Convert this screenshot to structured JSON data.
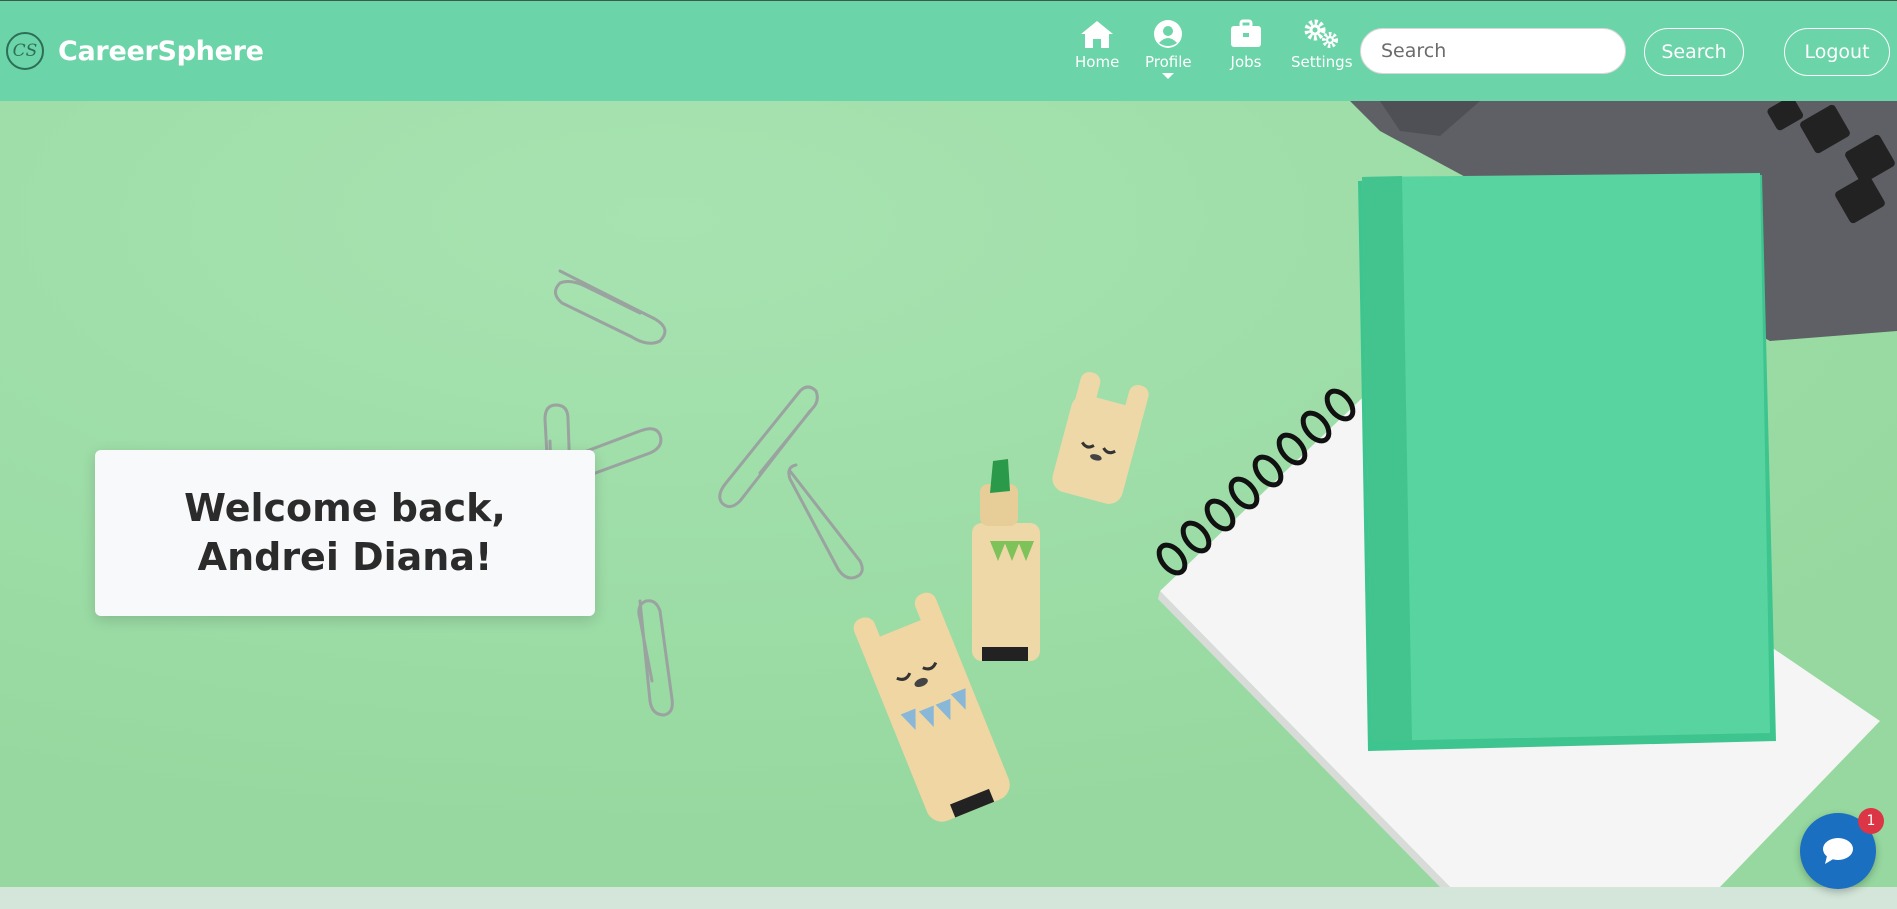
{
  "brand": {
    "logo_text": "CS",
    "name": "CareerSphere"
  },
  "nav": {
    "items": [
      {
        "label": "Home",
        "icon": "home-icon"
      },
      {
        "label": "Profile",
        "icon": "user-circle-icon",
        "has_dropdown": true
      },
      {
        "label": "Jobs",
        "icon": "briefcase-icon"
      },
      {
        "label": "Settings",
        "icon": "cogs-icon"
      }
    ],
    "search_placeholder": "Search",
    "search_button": "Search",
    "logout_button": "Logout"
  },
  "hero": {
    "welcome_message": "Welcome back, Andrei Diana!"
  },
  "chat": {
    "icon": "chat-bubble-icon",
    "badge_count": "1"
  },
  "colors": {
    "navbar": "#6bd4a8",
    "hero_background": "#9fdba7",
    "chat_button": "#1a6fc1",
    "badge": "#dc3545"
  }
}
